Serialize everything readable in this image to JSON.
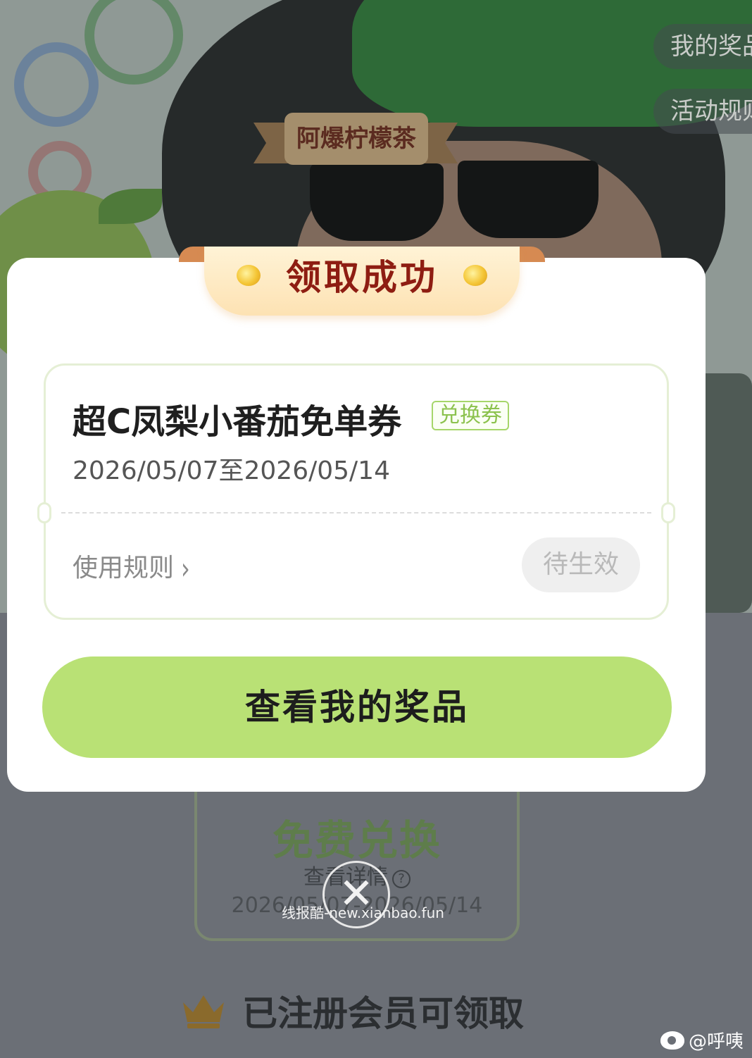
{
  "header": {
    "my_prizes_label": "我的奖品",
    "activity_rules_label": "活动规则",
    "brand_name": "阿爆柠檬茶"
  },
  "modal": {
    "title": "领取成功",
    "coupon": {
      "name": "超C凤梨小番茄免单券",
      "type_tag": "兑换券",
      "validity": "2026/05/07至2026/05/14",
      "rules_label": "使用规则",
      "status_label": "待生效"
    },
    "cta_label": "查看我的奖品",
    "close_icon": "close-icon"
  },
  "background_card": {
    "exchange_label": "免费兑换",
    "detail_label": "查看详情",
    "dates": "2026/05/07-2026/05/14"
  },
  "membership": {
    "text": "已注册会员可领取",
    "icon": "crown-icon"
  },
  "watermark": "线报酷-new.xianbao.fun",
  "weibo_credit": "@呼咦",
  "colors": {
    "cta_green": "#b9e175",
    "tag_green": "#8cc24e",
    "title_red": "#8e1d12",
    "ribbon_gold": "#fde2b3"
  }
}
